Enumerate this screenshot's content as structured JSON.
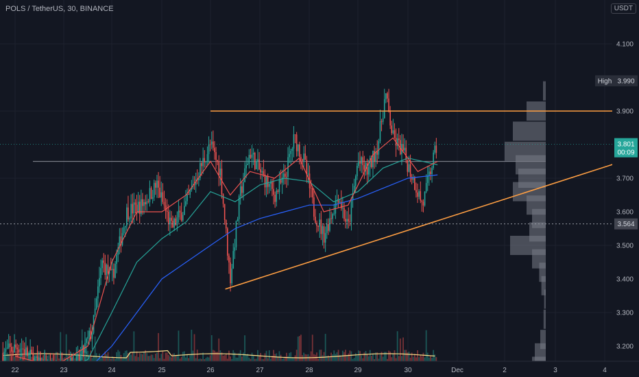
{
  "header": {
    "symbol": "POLS / TetherUS, 30, BINANCE",
    "currency": "USDT"
  },
  "colors": {
    "background": "#131722",
    "grid": "#1e222d",
    "axis_text": "#b2b5be",
    "candle_up": "#26a69a",
    "candle_down": "#ef5350",
    "trendline": "#ff9f43",
    "volume_profile": "#787b86",
    "sma_fast": "#ef5350",
    "sma_mid": "#26a69a",
    "sma_slow": "#2962ff",
    "volume_ma": "#ffe08a",
    "last_price_label": "#26a69a"
  },
  "chart_data": {
    "type": "candlestick",
    "title": "POLS / TetherUS, 30, BINANCE",
    "x_ticks": [
      "22",
      "23",
      "24",
      "25",
      "26",
      "27",
      "28",
      "29",
      "30",
      "Dec",
      "2",
      "3",
      "4"
    ],
    "y_ticks": [
      "4.100",
      "3.990",
      "3.900",
      "3.801",
      "3.700",
      "3.600",
      "3.564",
      "3.500",
      "3.400",
      "3.300",
      "3.200"
    ],
    "ylim": [
      3.1,
      4.2
    ],
    "high": {
      "label": "High",
      "value": 3.99
    },
    "last_price": {
      "value": 3.801,
      "countdown": "00:09"
    },
    "level_marker": {
      "value": 3.564
    },
    "price_path": [
      [
        "21.75",
        3.18
      ],
      [
        "22.1",
        3.2
      ],
      [
        "22.5",
        3.14
      ],
      [
        "22.8",
        3.13
      ],
      [
        "23.0",
        3.14
      ],
      [
        "23.3",
        3.15
      ],
      [
        "23.6",
        3.25
      ],
      [
        "23.8",
        3.45
      ],
      [
        "24.0",
        3.4
      ],
      [
        "24.3",
        3.6
      ],
      [
        "24.6",
        3.62
      ],
      [
        "24.9",
        3.68
      ],
      [
        "25.2",
        3.55
      ],
      [
        "25.5",
        3.62
      ],
      [
        "25.7",
        3.7
      ],
      [
        "26.0",
        3.8
      ],
      [
        "26.2",
        3.72
      ],
      [
        "26.4",
        3.4
      ],
      [
        "26.6",
        3.65
      ],
      [
        "26.8",
        3.78
      ],
      [
        "27.0",
        3.72
      ],
      [
        "27.3",
        3.65
      ],
      [
        "27.5",
        3.7
      ],
      [
        "27.7",
        3.82
      ],
      [
        "27.9",
        3.75
      ],
      [
        "28.1",
        3.6
      ],
      [
        "28.3",
        3.53
      ],
      [
        "28.6",
        3.65
      ],
      [
        "28.8",
        3.55
      ],
      [
        "29.0",
        3.75
      ],
      [
        "29.2",
        3.72
      ],
      [
        "29.4",
        3.8
      ],
      [
        "29.55",
        3.95
      ],
      [
        "29.7",
        3.82
      ],
      [
        "29.9",
        3.78
      ],
      [
        "30.1",
        3.7
      ],
      [
        "30.3",
        3.62
      ],
      [
        "30.5",
        3.75
      ],
      [
        "30.6",
        3.801
      ]
    ],
    "sma_fast": [
      [
        "22.0",
        3.17
      ],
      [
        "22.8",
        3.14
      ],
      [
        "23.5",
        3.2
      ],
      [
        "24.0",
        3.45
      ],
      [
        "24.5",
        3.6
      ],
      [
        "25.0",
        3.6
      ],
      [
        "25.5",
        3.65
      ],
      [
        "26.0",
        3.75
      ],
      [
        "26.4",
        3.65
      ],
      [
        "26.8",
        3.72
      ],
      [
        "27.3",
        3.7
      ],
      [
        "27.8",
        3.76
      ],
      [
        "28.3",
        3.6
      ],
      [
        "28.8",
        3.62
      ],
      [
        "29.3",
        3.77
      ],
      [
        "29.7",
        3.82
      ],
      [
        "30.2",
        3.72
      ],
      [
        "30.6",
        3.75
      ]
    ],
    "sma_mid": [
      [
        "22.0",
        3.15
      ],
      [
        "23.0",
        3.13
      ],
      [
        "23.5",
        3.16
      ],
      [
        "24.0",
        3.3
      ],
      [
        "24.5",
        3.45
      ],
      [
        "25.0",
        3.52
      ],
      [
        "25.5",
        3.57
      ],
      [
        "26.0",
        3.66
      ],
      [
        "26.5",
        3.63
      ],
      [
        "27.0",
        3.68
      ],
      [
        "27.5",
        3.7
      ],
      [
        "28.0",
        3.69
      ],
      [
        "28.5",
        3.63
      ],
      [
        "29.0",
        3.66
      ],
      [
        "29.5",
        3.73
      ],
      [
        "30.0",
        3.76
      ],
      [
        "30.6",
        3.74
      ]
    ],
    "sma_slow": [
      [
        "22.5",
        3.13
      ],
      [
        "23.5",
        3.13
      ],
      [
        "24.0",
        3.2
      ],
      [
        "24.5",
        3.3
      ],
      [
        "25.0",
        3.4
      ],
      [
        "25.5",
        3.45
      ],
      [
        "26.0",
        3.5
      ],
      [
        "26.5",
        3.55
      ],
      [
        "27.0",
        3.58
      ],
      [
        "27.5",
        3.6
      ],
      [
        "28.0",
        3.62
      ],
      [
        "28.5",
        3.62
      ],
      [
        "29.0",
        3.64
      ],
      [
        "29.5",
        3.67
      ],
      [
        "30.0",
        3.7
      ],
      [
        "30.6",
        3.71
      ]
    ],
    "trendlines": [
      {
        "name": "resistance",
        "from": [
          "26.0",
          3.9
        ],
        "to": [
          "Dec 3.7",
          3.9
        ]
      },
      {
        "name": "support",
        "from": [
          "26.3",
          3.37
        ],
        "to": [
          "Dec 3.35",
          3.75
        ]
      }
    ],
    "volume_profile": [
      [
        3.96,
        0.05
      ],
      [
        3.9,
        0.35
      ],
      [
        3.84,
        0.6
      ],
      [
        3.78,
        0.75
      ],
      [
        3.74,
        0.55
      ],
      [
        3.7,
        0.5
      ],
      [
        3.66,
        0.6
      ],
      [
        3.62,
        0.35
      ],
      [
        3.58,
        0.25
      ],
      [
        3.54,
        0.3
      ],
      [
        3.5,
        0.65
      ],
      [
        3.46,
        0.25
      ],
      [
        3.42,
        0.12
      ],
      [
        3.38,
        0.08
      ],
      [
        3.34,
        0.03
      ],
      [
        3.28,
        0.04
      ],
      [
        3.22,
        0.1
      ],
      [
        3.18,
        0.2
      ],
      [
        3.14,
        0.25
      ]
    ]
  }
}
